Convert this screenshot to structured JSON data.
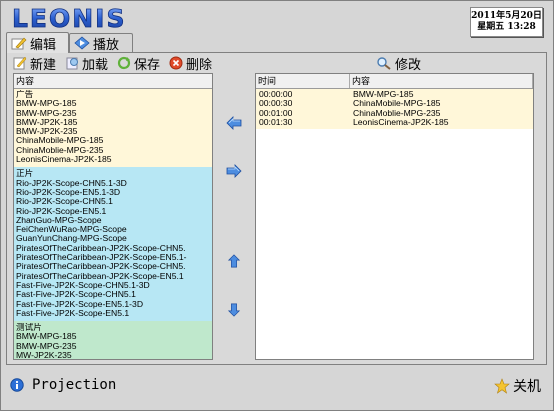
{
  "app": {
    "logo_text": "LEONIS"
  },
  "datetime": {
    "date": "2011年5月20日",
    "weekday_time": "星期五  13:28"
  },
  "tabs": [
    {
      "label": "编辑",
      "active": true
    },
    {
      "label": "播放",
      "active": false
    }
  ],
  "toolbar": {
    "new_label": "新建",
    "load_label": "加载",
    "save_label": "保存",
    "delete_label": "删除",
    "modify_label": "修改"
  },
  "library": {
    "header": "内容",
    "groups": [
      {
        "title": "广告",
        "color": "#fff7d9",
        "items": [
          "BMW-MPG-185",
          "BMW-MPG-235",
          "BMW-JP2K-185",
          "BMW-JP2K-235",
          "ChinaMobile-MPG-185",
          "ChinaMoblie-MPG-235",
          "LeonisCinema-JP2K-185"
        ]
      },
      {
        "title": "正片",
        "color": "#b7e7f4",
        "items": [
          "Rio-JP2K-Scope-CHN5.1-3D",
          "Rio-JP2K-Scope-EN5.1-3D",
          "Rio-JP2K-Scope-CHN5.1",
          "Rio-JP2K-Scope-EN5.1",
          "ZhanGuo-MPG-Scope",
          "FeiChenWuRao-MPG-Scope",
          "GuanYunChang-MPG-Scope",
          "PiratesOfTheCaribbean-JP2K-Scope-CHN5.",
          "PiratesOfTheCaribbean-JP2K-Scope-EN5.1-",
          "PiratesOfTheCaribbean-JP2K-Scope-CHN5.",
          "PiratesOfTheCaribbean-JP2K-Scope-EN5.1",
          "Fast-Five-JP2K-Scope-CHN5.1-3D",
          "Fast-Five-JP2K-Scope-CHN5.1",
          "Fast-Five-JP2K-Scope-EN5.1-3D",
          "Fast-Five-JP2K-Scope-EN5.1"
        ]
      },
      {
        "title": "测试片",
        "color": "#bfe8cc",
        "items": [
          "BMW-MPG-185",
          "BMW-MPG-235",
          "MW-JP2K-235"
        ]
      }
    ]
  },
  "schedule": {
    "headers": {
      "time": "时间",
      "content": "内容"
    },
    "rows": [
      {
        "time": "00:00:00",
        "content": "BMW-MPG-185"
      },
      {
        "time": "00:00:30",
        "content": "ChinaMobile-MPG-185"
      },
      {
        "time": "00:01:00",
        "content": "ChinaMoblie-MPG-235"
      },
      {
        "time": "00:01:30",
        "content": "LeonisCinema-JP2K-185"
      }
    ]
  },
  "status": {
    "mode_label": "Projection",
    "shutdown_label": "关机"
  },
  "colors": {
    "logo_blue": "#2b5fd0",
    "ad_bg": "#fff7d9",
    "main_bg": "#b7e7f4",
    "test_bg": "#bfe8cc",
    "arrow_blue": "#4d8de0"
  }
}
